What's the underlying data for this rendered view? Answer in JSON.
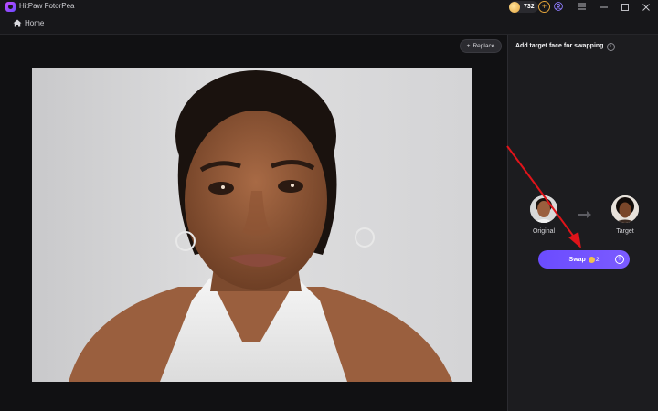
{
  "app": {
    "title": "HitPaw FotorPea",
    "coin_count": "732"
  },
  "breadcrumb": {
    "home_label": "Home"
  },
  "canvas": {
    "replace_label": "Replace"
  },
  "panel": {
    "title": "Add target face for swapping",
    "original_label": "Original",
    "target_label": "Target",
    "swap_label": "Swap",
    "swap_cost": "2"
  },
  "colors": {
    "accent": "#6b4cff",
    "annotation": "#e0141a",
    "coin": "#e3a43c"
  },
  "icons": [
    "app-logo-icon",
    "coin-icon",
    "add-coin-icon",
    "profile-icon",
    "menu-icon",
    "minimize-icon",
    "maximize-icon",
    "close-icon",
    "home-icon",
    "plus-icon",
    "info-icon",
    "arrow-right-icon",
    "help-icon"
  ]
}
